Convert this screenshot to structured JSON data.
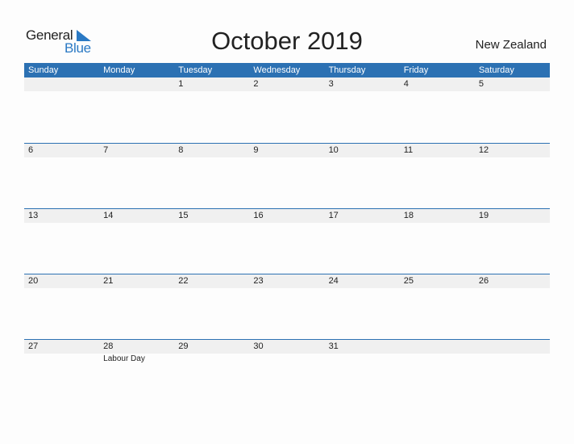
{
  "logo": {
    "word1": "General",
    "word2": "Blue"
  },
  "title": "October 2019",
  "country": "New Zealand",
  "colors": {
    "accent": "#2c71b3",
    "strip": "#f0f0f0"
  },
  "weekdays": [
    "Sunday",
    "Monday",
    "Tuesday",
    "Wednesday",
    "Thursday",
    "Friday",
    "Saturday"
  ],
  "weeks": [
    [
      "",
      "",
      "1",
      "2",
      "3",
      "4",
      "5"
    ],
    [
      "6",
      "7",
      "8",
      "9",
      "10",
      "11",
      "12"
    ],
    [
      "13",
      "14",
      "15",
      "16",
      "17",
      "18",
      "19"
    ],
    [
      "20",
      "21",
      "22",
      "23",
      "24",
      "25",
      "26"
    ],
    [
      "27",
      "28",
      "29",
      "30",
      "31",
      "",
      ""
    ]
  ],
  "holidays": {
    "28": "Labour Day"
  }
}
